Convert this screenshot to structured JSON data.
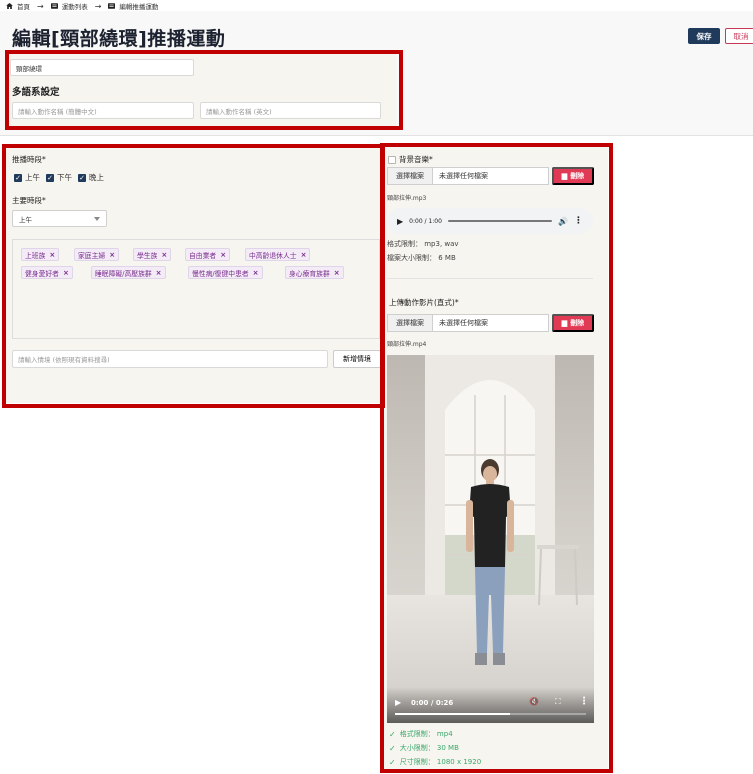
{
  "breadcrumb": {
    "items": [
      "首頁",
      "運動列表",
      "編輯推播運動"
    ]
  },
  "page": {
    "title": "編輯[頸部繞環]推播運動",
    "save_label": "保存",
    "cancel_label": "取消"
  },
  "basic": {
    "name_value": "頸部繞環",
    "multilang_heading": "多語系設定",
    "name_zh_placeholder": "請輸入動作名稱 (簡體中文)",
    "name_en_placeholder": "請輸入動作名稱 (英文)"
  },
  "schedule": {
    "periods_label": "推播時段*",
    "periods": [
      {
        "label": "上午",
        "checked": true
      },
      {
        "label": "下午",
        "checked": true
      },
      {
        "label": "晚上",
        "checked": true
      }
    ],
    "main_label": "主要時段*",
    "main_value": "上午",
    "tags": [
      "上班族",
      "家庭主婦",
      "學生族",
      "自由業者",
      "中高齡退休人士",
      "健身愛好者",
      "睡眠障礙/高壓族群",
      "慢性病/復健中患者",
      "身心療育族群"
    ],
    "scenario_placeholder": "請輸入情境 (依照現有資料搜尋)",
    "add_scenario_label": "新增情境"
  },
  "music": {
    "label": "背景音樂*",
    "choose_label": "選擇檔案",
    "file_status": "未選擇任何檔案",
    "delete_label": "刪除",
    "file_name": "頸部拉伸.mp3",
    "time": "0:00 / 1:00",
    "format_text": "格式限制： mp3, wav",
    "size_text": "檔案大小限制： 6 MB"
  },
  "video": {
    "label": "上傳動作影片(直式)*",
    "choose_label": "選擇檔案",
    "file_status": "未選擇任何檔案",
    "delete_label": "刪除",
    "file_name": "頸部拉伸.mp4",
    "time": "0:00 / 0:26",
    "progress": 0.6,
    "checks": [
      "格式限制： mp4",
      "大小限制： 30 MB",
      "尺寸限制： 1080 x 1920"
    ]
  },
  "colors": {
    "primary": "#1f3a5a",
    "danger": "#e13a55",
    "tag_text": "#7b2d8e",
    "ok": "#3aa86b",
    "highlight": "#c00000"
  }
}
